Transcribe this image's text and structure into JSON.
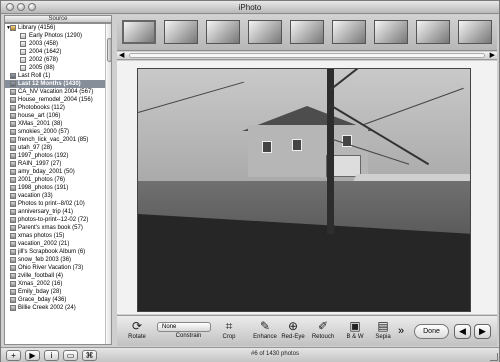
{
  "window": {
    "title": "iPhoto"
  },
  "sidebar": {
    "header": "Source",
    "items": [
      {
        "label": "Library (4156)",
        "type": "library",
        "expanded": true
      },
      {
        "label": "Early Photos (1290)",
        "type": "folder",
        "child": true
      },
      {
        "label": "2003 (458)",
        "type": "folder",
        "child": true
      },
      {
        "label": "2004 (1642)",
        "type": "folder",
        "child": true
      },
      {
        "label": "2002 (678)",
        "type": "folder",
        "child": true
      },
      {
        "label": "2005 (88)",
        "type": "folder",
        "child": true
      },
      {
        "label": "Last Roll (1)",
        "type": "roll"
      },
      {
        "label": "Last 12 Months (1430)",
        "type": "roll",
        "selected": true
      },
      {
        "label": "CA_NV Vacation 2004 (567)",
        "type": "album"
      },
      {
        "label": "House_remodel_2004 (156)",
        "type": "album"
      },
      {
        "label": "Photobooks (112)",
        "type": "album"
      },
      {
        "label": "house_art (106)",
        "type": "album"
      },
      {
        "label": "XMas_2001 (38)",
        "type": "album"
      },
      {
        "label": "smokies_2000 (57)",
        "type": "album"
      },
      {
        "label": "french_lick_vac_2001 (85)",
        "type": "album"
      },
      {
        "label": "utah_97 (28)",
        "type": "album"
      },
      {
        "label": "1997_photos (192)",
        "type": "album"
      },
      {
        "label": "RAIN_1997 (27)",
        "type": "album"
      },
      {
        "label": "amy_bday_2001 (50)",
        "type": "album"
      },
      {
        "label": "2001_photos (76)",
        "type": "album"
      },
      {
        "label": "1998_photos (191)",
        "type": "album"
      },
      {
        "label": "vacation (33)",
        "type": "album"
      },
      {
        "label": "Photos to print--8/02 (10)",
        "type": "album"
      },
      {
        "label": "anniversary_trip (41)",
        "type": "album"
      },
      {
        "label": "photos-to-print--12-02 (72)",
        "type": "album"
      },
      {
        "label": "Parent's xmas book (57)",
        "type": "album"
      },
      {
        "label": "xmas photos (15)",
        "type": "album"
      },
      {
        "label": "vacation_2002 (21)",
        "type": "album"
      },
      {
        "label": "jill's Scrapbook Album (6)",
        "type": "album"
      },
      {
        "label": "snow_feb 2003 (36)",
        "type": "album"
      },
      {
        "label": "Ohio River Vacation (73)",
        "type": "album"
      },
      {
        "label": "zville_football (4)",
        "type": "album"
      },
      {
        "label": "Xmas_2002 (16)",
        "type": "album"
      },
      {
        "label": "Emily_bday (28)",
        "type": "album"
      },
      {
        "label": "Grace_bday (436)",
        "type": "album"
      },
      {
        "label": "Billie Creek 2002 (24)",
        "type": "album"
      }
    ]
  },
  "toolbar": {
    "rotate": "Rotate",
    "constrain": "Constrain",
    "constrain_value": "None",
    "crop": "Crop",
    "enhance": "Enhance",
    "red_eye": "Red-Eye",
    "retouch": "Retouch",
    "bw": "B & W",
    "sepia": "Sepia",
    "more": "»",
    "done": "Done",
    "prev": "◀",
    "next": "▶"
  },
  "footer": {
    "photo_count": "#6 of 1430 photos",
    "buttons": [
      "+",
      "▶",
      "i",
      "▭",
      "⌘"
    ]
  },
  "icons": {
    "rotate": "rotate-icon",
    "constrain": "constrain-icon",
    "crop": "crop-icon",
    "enhance": "enhance-icon",
    "red_eye": "red-eye-icon",
    "retouch": "retouch-icon",
    "bw": "black-white-icon",
    "sepia": "sepia-icon"
  }
}
